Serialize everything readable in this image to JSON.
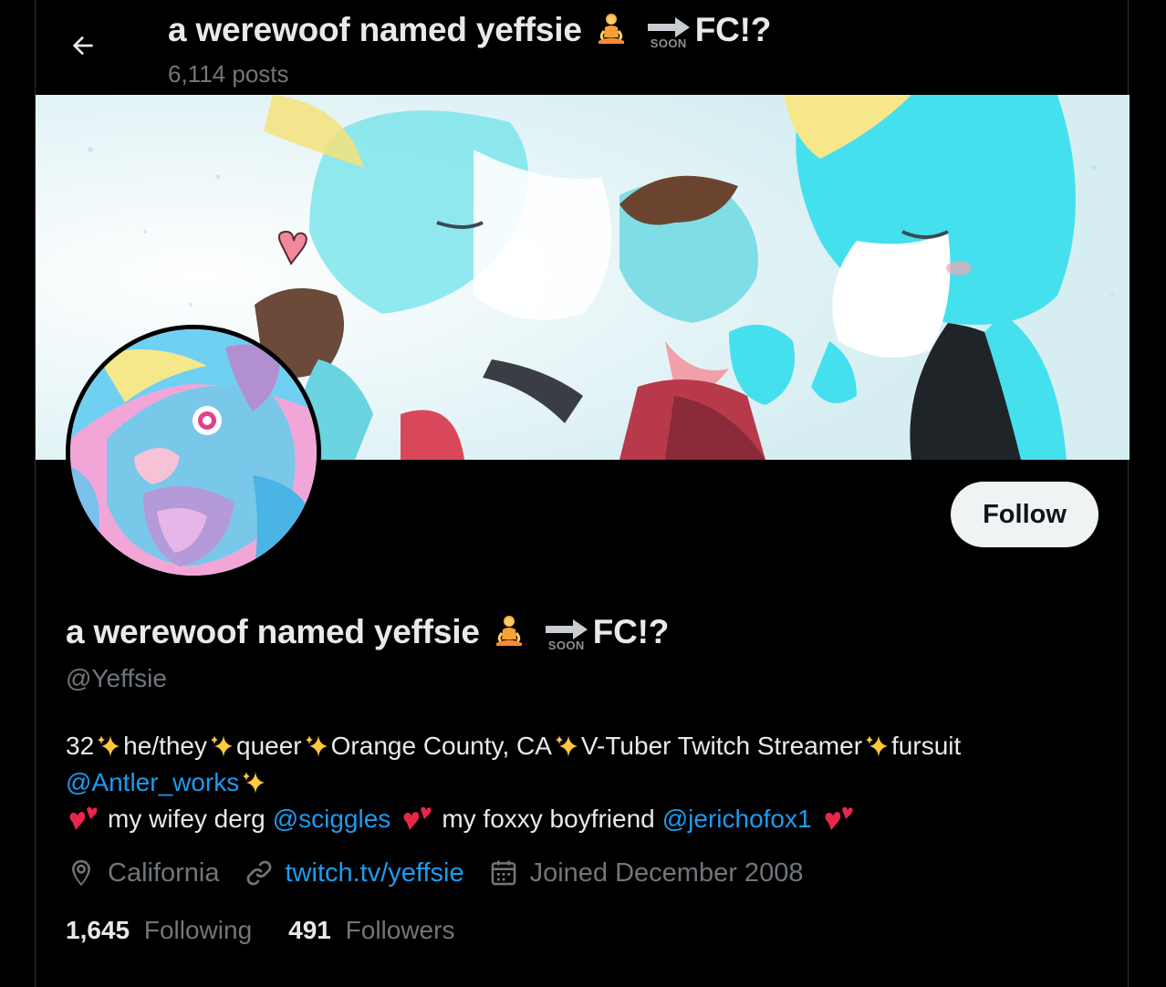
{
  "header": {
    "title_text": "a werewoof named yeffsie",
    "title_suffix": "FC!?",
    "soon_label": "SOON",
    "post_count": "6,114 posts"
  },
  "profile": {
    "name_text": "a werewoof named yeffsie",
    "name_suffix": "FC!?",
    "soon_label": "SOON",
    "handle": "@Yeffsie",
    "follow_label": "Follow",
    "bio": {
      "line1_parts": [
        "32",
        "he/they",
        "queer",
        "Orange County, CA",
        "V-Tuber Twitch Streamer",
        "fursuit"
      ],
      "mention_antler": "@Antler_works",
      "line3_wifey": "my wifey derg",
      "mention_sciggles": "@sciggles",
      "line3_bf": "my foxxy boyfriend",
      "mention_jericho": "@jerichofox1"
    },
    "location": "California",
    "website": "twitch.tv/yeffsie",
    "joined": "Joined December 2008",
    "following_count": "1,645",
    "following_label": "Following",
    "followers_count": "491",
    "followers_label": "Followers"
  },
  "icons": {
    "back": "arrow-left-icon",
    "location": "location-pin-icon",
    "link": "link-icon",
    "calendar": "calendar-icon",
    "sparkles": "sparkles-emoji",
    "hearts": "two-hearts-emoji",
    "person": "person-lotus-emoji"
  },
  "colors": {
    "accent": "#1d9bf0",
    "background": "#000000",
    "text": "#e7e9ea",
    "secondary_text": "#71767b",
    "follow_bg": "#eff3f4"
  }
}
